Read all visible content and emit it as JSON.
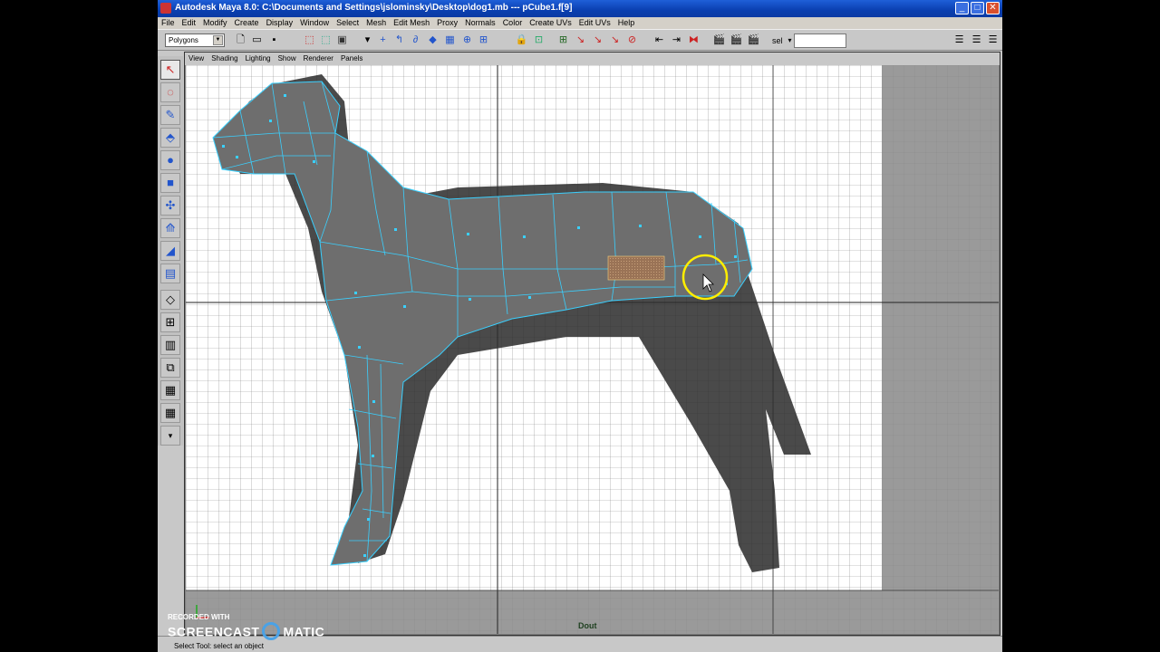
{
  "titlebar": {
    "title": "Autodesk Maya 8.0: C:\\Documents and Settings\\jslominsky\\Desktop\\dog1.mb   ---   pCube1.f[9]",
    "minimize": "_",
    "maximize": "□",
    "close": "✕"
  },
  "menubar": {
    "items": [
      "File",
      "Edit",
      "Modify",
      "Create",
      "Display",
      "Window",
      "Select",
      "Mesh",
      "Edit Mesh",
      "Proxy",
      "Normals",
      "Color",
      "Create UVs",
      "Edit UVs",
      "Help"
    ]
  },
  "shelf": {
    "mode_value": "Polygons",
    "sel_label": "sel",
    "sel_value": ""
  },
  "panel_menu": {
    "items": [
      "View",
      "Shading",
      "Lighting",
      "Show",
      "Renderer",
      "Panels"
    ]
  },
  "viewport": {
    "camera_label": "Dout"
  },
  "statusbar": {
    "text": "Select Tool: select an object"
  },
  "watermark": {
    "line1": "RECORDED WITH",
    "word1": "SCREENCAST",
    "word2": "MATIC"
  },
  "colors": {
    "title_blue": "#0a3fb0",
    "wire_cyan": "#3ad0ff",
    "mesh_gray": "#6e6e6e",
    "selected_face": "#a07a5a",
    "cursor_highlight": "#ffee00"
  },
  "icons": {
    "toolbox": [
      "select-arrow-icon",
      "lasso-icon",
      "paint-select-icon",
      "move-icon",
      "rotate-icon",
      "scale-icon",
      "soft-mod-icon",
      "show-manip-icon",
      "last-tool-icon",
      "sculpt-icon"
    ]
  }
}
